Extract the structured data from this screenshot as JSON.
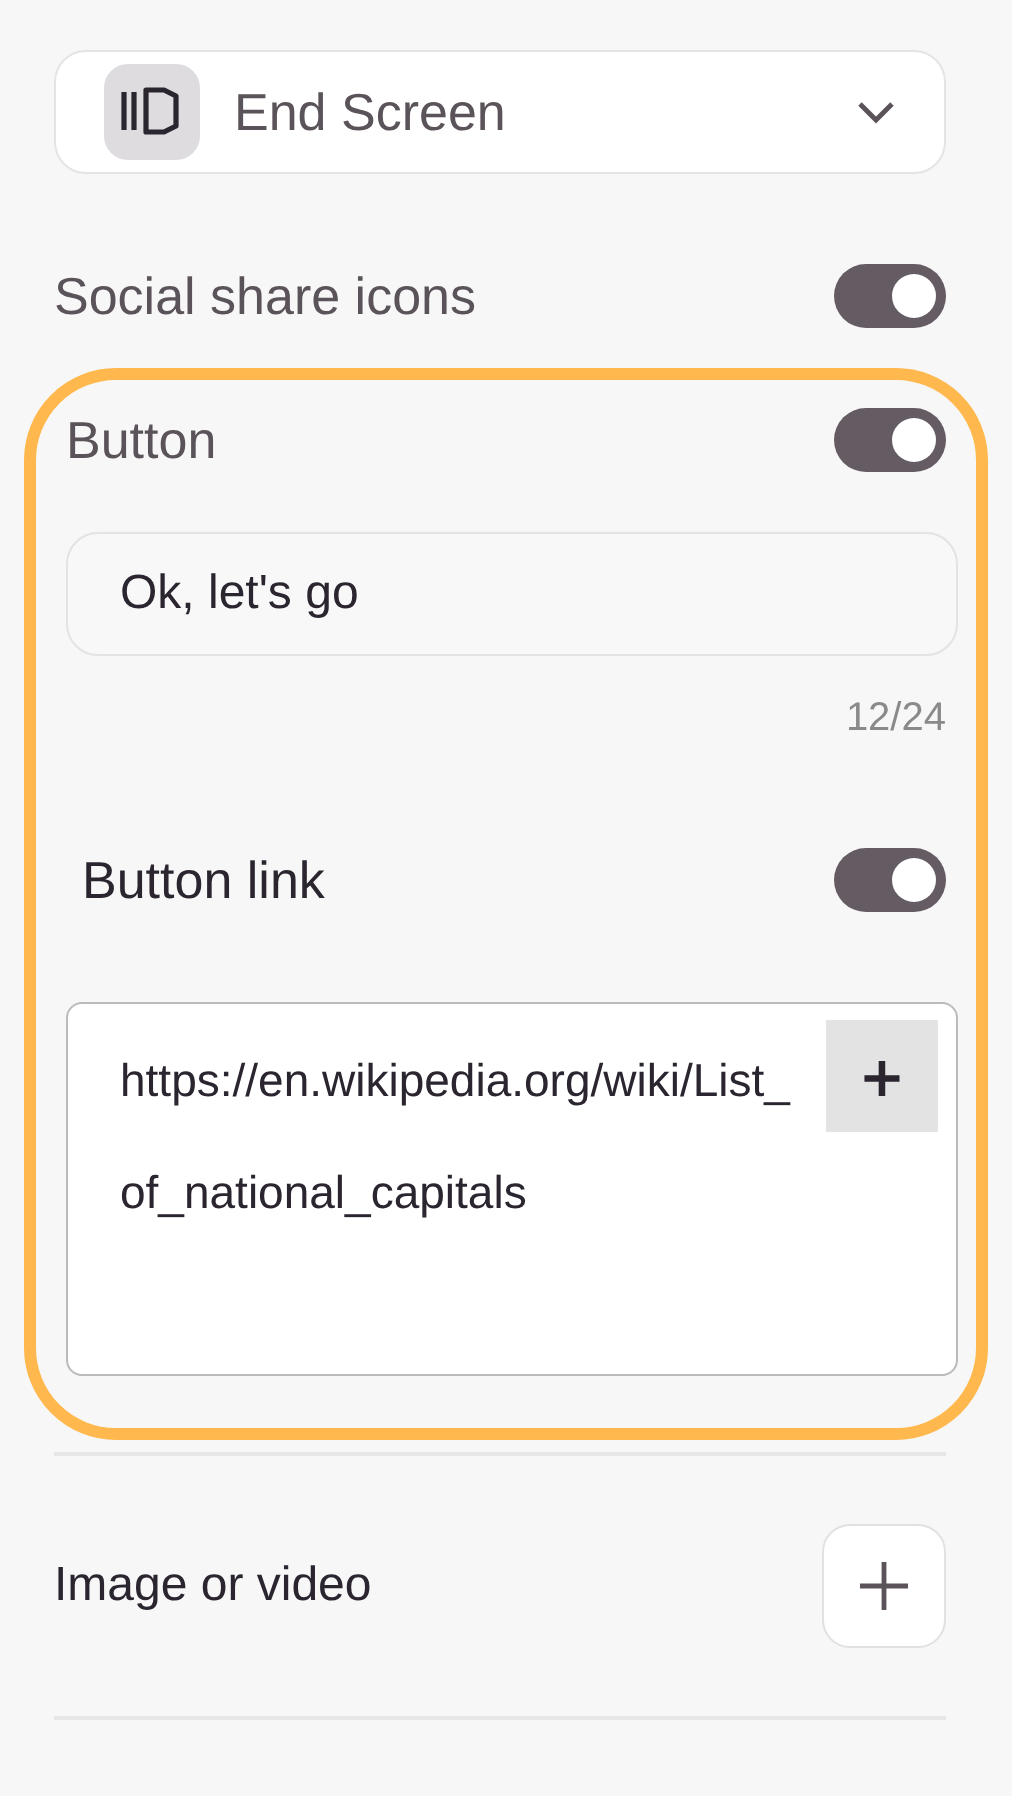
{
  "dropdown": {
    "label": "End Screen"
  },
  "social_share": {
    "label": "Social share icons",
    "on": true
  },
  "button_section": {
    "highlighted": true,
    "toggle": {
      "label": "Button",
      "on": true
    },
    "text_field": {
      "value": "Ok, let's go",
      "counter": "12/24"
    },
    "link_toggle": {
      "label": "Button link",
      "on": true
    },
    "link_field": {
      "value": "https://en.wikipedia.org/wiki/List_of_national_capitals",
      "add_label": "+"
    }
  },
  "media": {
    "label": "Image or video"
  }
}
